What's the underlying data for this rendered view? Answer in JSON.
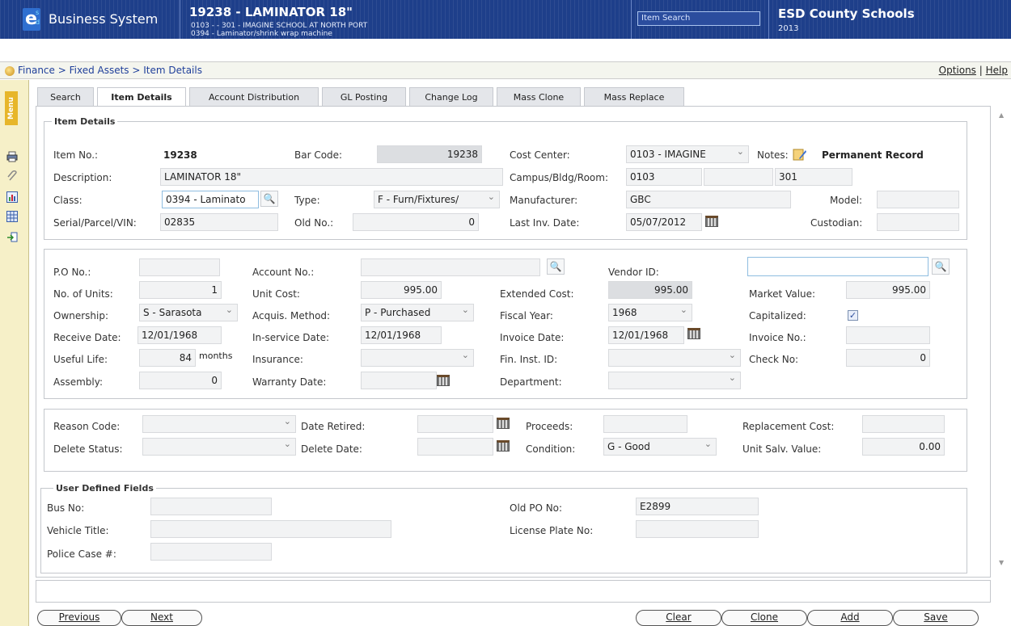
{
  "header": {
    "brand": "Business System",
    "item_title": "19238 - LAMINATOR 18\"",
    "item_sub1": "0103 - - 301 - IMAGINE SCHOOL AT NORTH PORT",
    "item_sub2": "0394 - Laminator/shrink wrap machine",
    "search_placeholder": "Item Search",
    "org": "ESD County Schools",
    "year": "2013"
  },
  "breadcrumb": "Finance > Fixed Assets > Item Details",
  "top_links": {
    "options": "Options",
    "sep": "|",
    "help": "Help"
  },
  "sidebar": {
    "menu_label": "Menu"
  },
  "tabs": [
    "Search",
    "Item Details",
    "Account Distribution",
    "GL Posting",
    "Change Log",
    "Mass Clone",
    "Mass Replace"
  ],
  "item_details": {
    "legend": "Item Details",
    "item_no_label": "Item No.:",
    "item_no": "19238",
    "bar_code_label": "Bar Code:",
    "bar_code": "19238",
    "cost_center_label": "Cost Center:",
    "cost_center": "0103 - IMAGINE",
    "notes_label": "Notes:",
    "permanent_record": "Permanent Record",
    "description_label": "Description:",
    "description": "LAMINATOR 18\"",
    "campus_label": "Campus/Bldg/Room:",
    "campus": "0103",
    "bldg": "",
    "room": "301",
    "class_label": "Class:",
    "class": "0394 - Laminato",
    "type_label": "Type:",
    "type": "F - Furn/Fixtures/",
    "manufacturer_label": "Manufacturer:",
    "manufacturer": "GBC",
    "model_label": "Model:",
    "model": "",
    "serial_label": "Serial/Parcel/VIN:",
    "serial": "02835",
    "old_no_label": "Old No.:",
    "old_no": "0",
    "last_inv_label": "Last Inv. Date:",
    "last_inv": "05/07/2012",
    "custodian_label": "Custodian:",
    "custodian": ""
  },
  "financial": {
    "po_label": "P.O No.:",
    "po": "",
    "account_label": "Account No.:",
    "account": "",
    "vendor_label": "Vendor ID:",
    "vendor": "",
    "units_label": "No. of Units:",
    "units": "1",
    "unit_cost_label": "Unit Cost:",
    "unit_cost": "995.00",
    "ext_cost_label": "Extended Cost:",
    "ext_cost": "995.00",
    "market_label": "Market Value:",
    "market": "995.00",
    "ownership_label": "Ownership:",
    "ownership": "S - Sarasota",
    "acq_label": "Acquis. Method:",
    "acq": "P - Purchased",
    "fiscal_label": "Fiscal Year:",
    "fiscal": "1968",
    "capitalized_label": "Capitalized:",
    "capitalized": "✓",
    "receive_label": "Receive Date:",
    "receive": "12/01/1968",
    "inservice_label": "In-service Date:",
    "inservice": "12/01/1968",
    "invoice_date_label": "Invoice Date:",
    "invoice_date": "12/01/1968",
    "invoice_no_label": "Invoice No.:",
    "invoice_no": "",
    "useful_label": "Useful Life:",
    "useful": "84",
    "months": "months",
    "insurance_label": "Insurance:",
    "insurance": "",
    "fininst_label": "Fin. Inst. ID:",
    "fininst": "",
    "check_label": "Check No:",
    "check": "0",
    "assembly_label": "Assembly:",
    "assembly": "0",
    "warranty_label": "Warranty Date:",
    "warranty": "",
    "department_label": "Department:",
    "department": ""
  },
  "retire": {
    "reason_label": "Reason Code:",
    "reason": "",
    "date_retired_label": "Date Retired:",
    "date_retired": "",
    "proceeds_label": "Proceeds:",
    "proceeds": "",
    "replacement_label": "Replacement Cost:",
    "replacement": "",
    "delete_status_label": "Delete Status:",
    "delete_status": "",
    "delete_date_label": "Delete Date:",
    "delete_date": "",
    "condition_label": "Condition:",
    "condition": "G - Good",
    "salv_label": "Unit Salv. Value:",
    "salv": "0.00"
  },
  "udf": {
    "legend": "User Defined Fields",
    "bus_label": "Bus No:",
    "bus": "",
    "old_po_label": "Old PO No:",
    "old_po": "E2899",
    "vehicle_label": "Vehicle Title:",
    "vehicle": "",
    "plate_label": "License Plate No:",
    "plate": "",
    "police_label": "Police Case #:",
    "police": ""
  },
  "buttons": {
    "previous": "Previous",
    "next": "Next",
    "clear": "Clear",
    "clone": "Clone",
    "add": "Add",
    "save": "Save"
  }
}
